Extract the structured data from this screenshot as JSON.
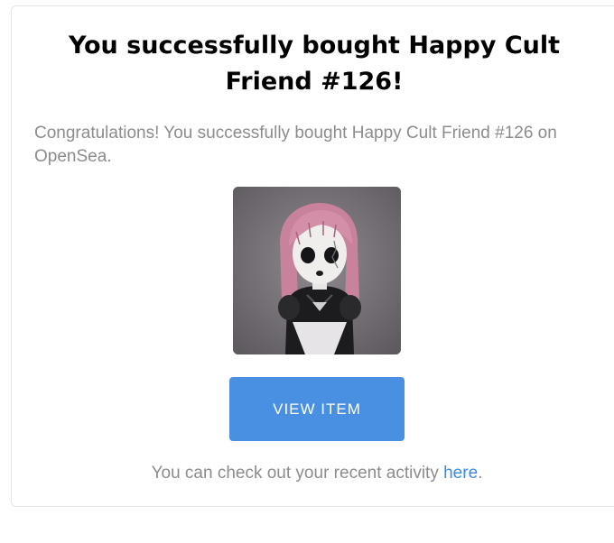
{
  "email": {
    "title_line1": "You successfully bought Happy Cult",
    "title_line2": "Friend #126!",
    "body": "Congratulations! You successfully bought Happy Cult Friend #126 on OpenSea.",
    "image_alt": "Happy Cult Friend #126",
    "button_label": "VIEW ITEM",
    "footer_prefix": "You can check out your recent activity ",
    "footer_link": "here",
    "footer_suffix": "."
  },
  "colors": {
    "button": "#4a90e2",
    "link": "#3f8ae2",
    "muted_text": "#8c8c8c",
    "title_text": "#000000"
  }
}
